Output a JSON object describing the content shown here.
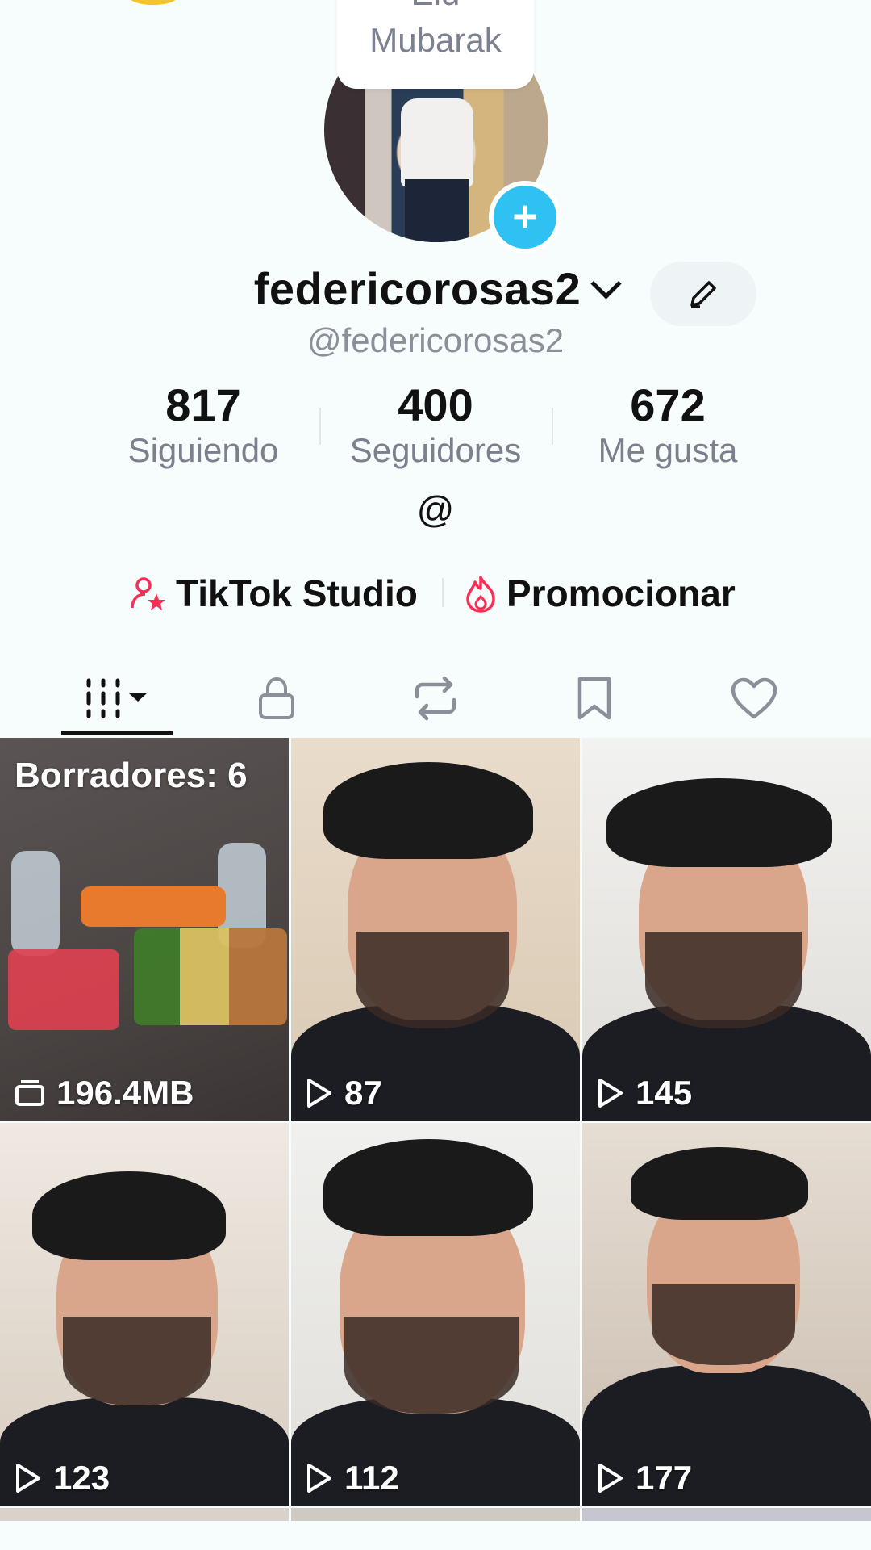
{
  "note": {
    "line1": "Eid",
    "line2": "Mubarak"
  },
  "profile": {
    "username": "federicorosas2",
    "handle": "@federicorosas2",
    "bio": "@"
  },
  "stats": [
    {
      "value": "817",
      "label": "Siguiendo"
    },
    {
      "value": "400",
      "label": "Seguidores"
    },
    {
      "value": "672",
      "label": "Me gusta"
    }
  ],
  "actions": {
    "studio": "TikTok Studio",
    "promote": "Promocionar"
  },
  "tabs": [
    "videos-grid-icon",
    "lock-icon",
    "repost-icon",
    "bookmark-icon",
    "heart-icon"
  ],
  "grid": {
    "draft_title": "Borradores: 6",
    "draft_size": "196.4MB",
    "videos": [
      {
        "views": "87"
      },
      {
        "views": "145"
      },
      {
        "views": "123"
      },
      {
        "views": "112"
      },
      {
        "views": "177"
      }
    ]
  },
  "colors": {
    "accent": "#2fc1f2",
    "studio_icon": "#fe2c55",
    "background": "#f7fcfc"
  }
}
